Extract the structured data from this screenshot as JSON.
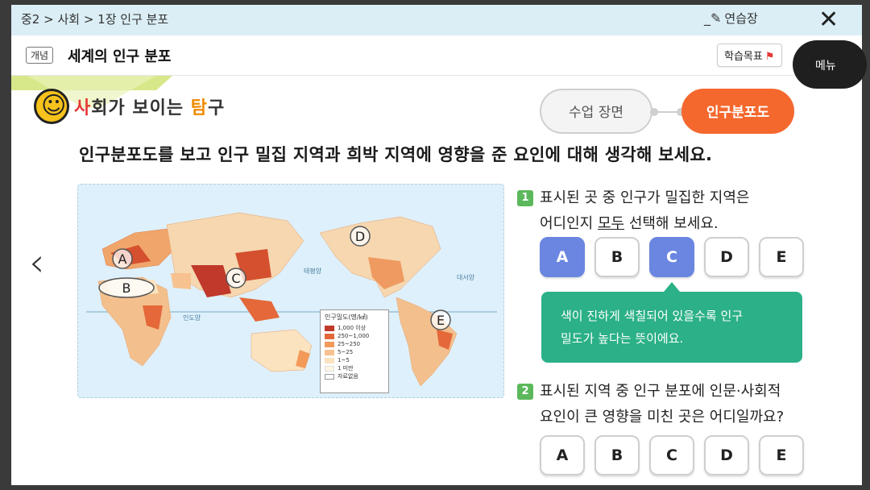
{
  "header": {
    "breadcrumb": "중2 > 사회 > 1장 인구 분포",
    "notebook_label": "연습장",
    "close_label": "✕"
  },
  "lesson": {
    "tag": "개념",
    "title": "세계의 인구 분포",
    "goals_label": "학습목표",
    "menu_label": "메뉴"
  },
  "logo": {
    "part1": "사",
    "part2": "회가 보이는 ",
    "part3": "탐",
    "part4": "구"
  },
  "tabs": [
    {
      "label": "수업 장면",
      "active": false
    },
    {
      "label": "인구분포도",
      "active": true
    }
  ],
  "main": {
    "question": "인구분포도를 보고 인구 밀집 지역과 희박 지역에 영향을 준 요인에 대해 생각해 보세요."
  },
  "map": {
    "labels": [
      "A",
      "B",
      "C",
      "D",
      "E"
    ],
    "ocean_labels": [
      "태평양",
      "대서양",
      "인도양"
    ],
    "legend": {
      "title": "인구밀도(명/㎢)",
      "items": [
        {
          "label": "1,000 이상",
          "color": "#c0392b"
        },
        {
          "label": "250~1,000",
          "color": "#e4683a"
        },
        {
          "label": "25~250",
          "color": "#f39a5a"
        },
        {
          "label": "5~25",
          "color": "#f7c28f"
        },
        {
          "label": "1~5",
          "color": "#fbe3bf"
        },
        {
          "label": "1 미만",
          "color": "#fff6e4"
        },
        {
          "label": "자료없음",
          "color": "#ffffff"
        }
      ]
    }
  },
  "q1": {
    "number": "1",
    "line1": "표시된 곳 중 인구가 밀집한 지역은",
    "line2_a": "어디인지 ",
    "line2_u": "모두",
    "line2_b": " 선택해 보세요.",
    "options": [
      "A",
      "B",
      "C",
      "D",
      "E"
    ],
    "selected": [
      "A",
      "C"
    ]
  },
  "hint": {
    "line1": "색이 진하게 색칠되어 있을수록 인구",
    "line2": "밀도가 높다는 뜻이에요."
  },
  "q2": {
    "number": "2",
    "line1": "표시된 지역 중 인구 분포에 인문·사회적",
    "line2": "요인이 큰 영향을 미친 곳은 어디일까요?",
    "options": [
      "A",
      "B",
      "C",
      "D",
      "E"
    ]
  },
  "colors": {
    "accent_orange": "#f4682e",
    "selected_blue": "#6a86e0",
    "hint_green": "#2bb087"
  }
}
